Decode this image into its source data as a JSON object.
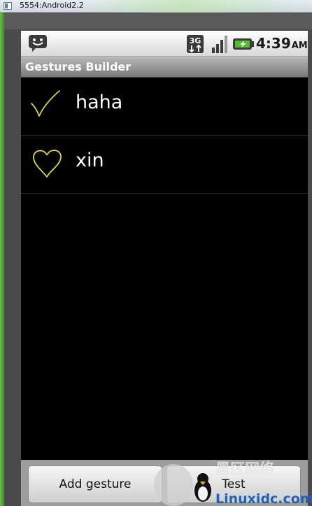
{
  "window": {
    "title": "5554:Android2.2"
  },
  "statusbar": {
    "notification_icon": "chat-bubble-icon",
    "network": "3G",
    "clock_time": "4:39",
    "clock_ampm": "AM"
  },
  "app": {
    "title": "Gestures Builder"
  },
  "gestures": [
    {
      "name": "haha",
      "icon": "checkmark-gesture-icon"
    },
    {
      "name": "xin",
      "icon": "heart-gesture-icon"
    }
  ],
  "buttons": {
    "add": "Add gesture",
    "test": "Test"
  },
  "watermark": {
    "brand": "Linuxidc.com",
    "cn": "黑区网络"
  },
  "colors": {
    "gesture_stroke": "#e6e21a",
    "background": "#000000"
  }
}
